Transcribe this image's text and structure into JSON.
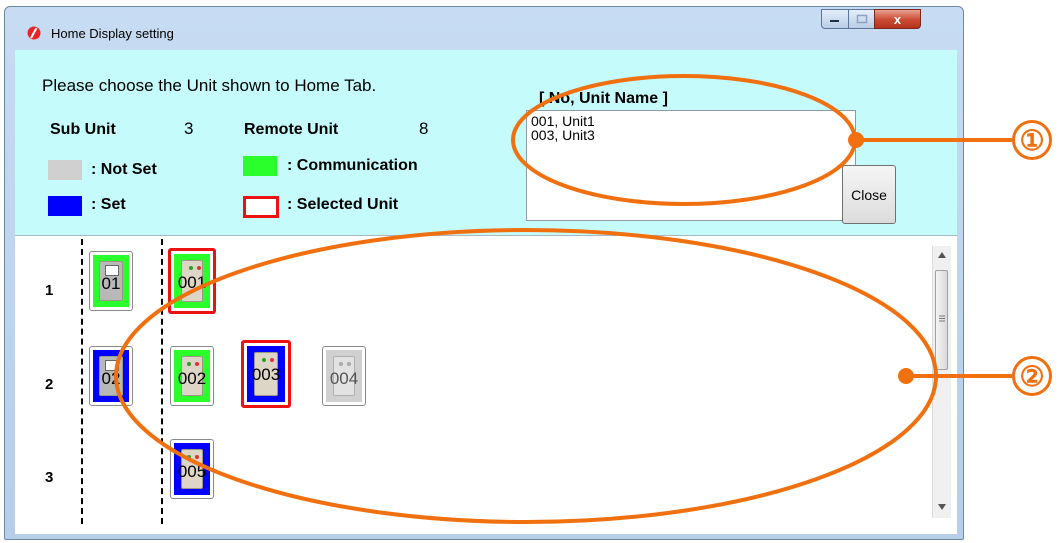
{
  "window": {
    "title": "Home Display setting",
    "close_glyph": "x"
  },
  "header": {
    "instruction": "Please choose the Unit shown to Home Tab.",
    "sub_unit_label": "Sub Unit",
    "sub_unit_count": "3",
    "remote_unit_label": "Remote Unit",
    "remote_unit_count": "8"
  },
  "legend": {
    "not_set": ": Not Set",
    "communication": ": Communication",
    "set": ": Set",
    "selected": ": Selected Unit",
    "colors": {
      "not_set": "#d0d0d0",
      "communication": "#2bff2b",
      "set": "#0000ff",
      "selected": "#ee1111"
    }
  },
  "list": {
    "header": "[ No, Unit Name ]",
    "items": [
      "001, Unit1",
      "003, Unit3"
    ]
  },
  "close_button": "Close",
  "rows": [
    {
      "label": "1"
    },
    {
      "label": "2"
    },
    {
      "label": "3"
    }
  ],
  "units": [
    {
      "label": "01",
      "state": "communication",
      "kind": "sub"
    },
    {
      "label": "001",
      "state": "communication",
      "selected": true
    },
    {
      "label": "02",
      "state": "set",
      "kind": "sub"
    },
    {
      "label": "002",
      "state": "communication"
    },
    {
      "label": "003",
      "state": "set",
      "selected": true
    },
    {
      "label": "004",
      "state": "not_set"
    },
    {
      "label": "005",
      "state": "set"
    }
  ],
  "callouts": [
    "①",
    "②"
  ]
}
